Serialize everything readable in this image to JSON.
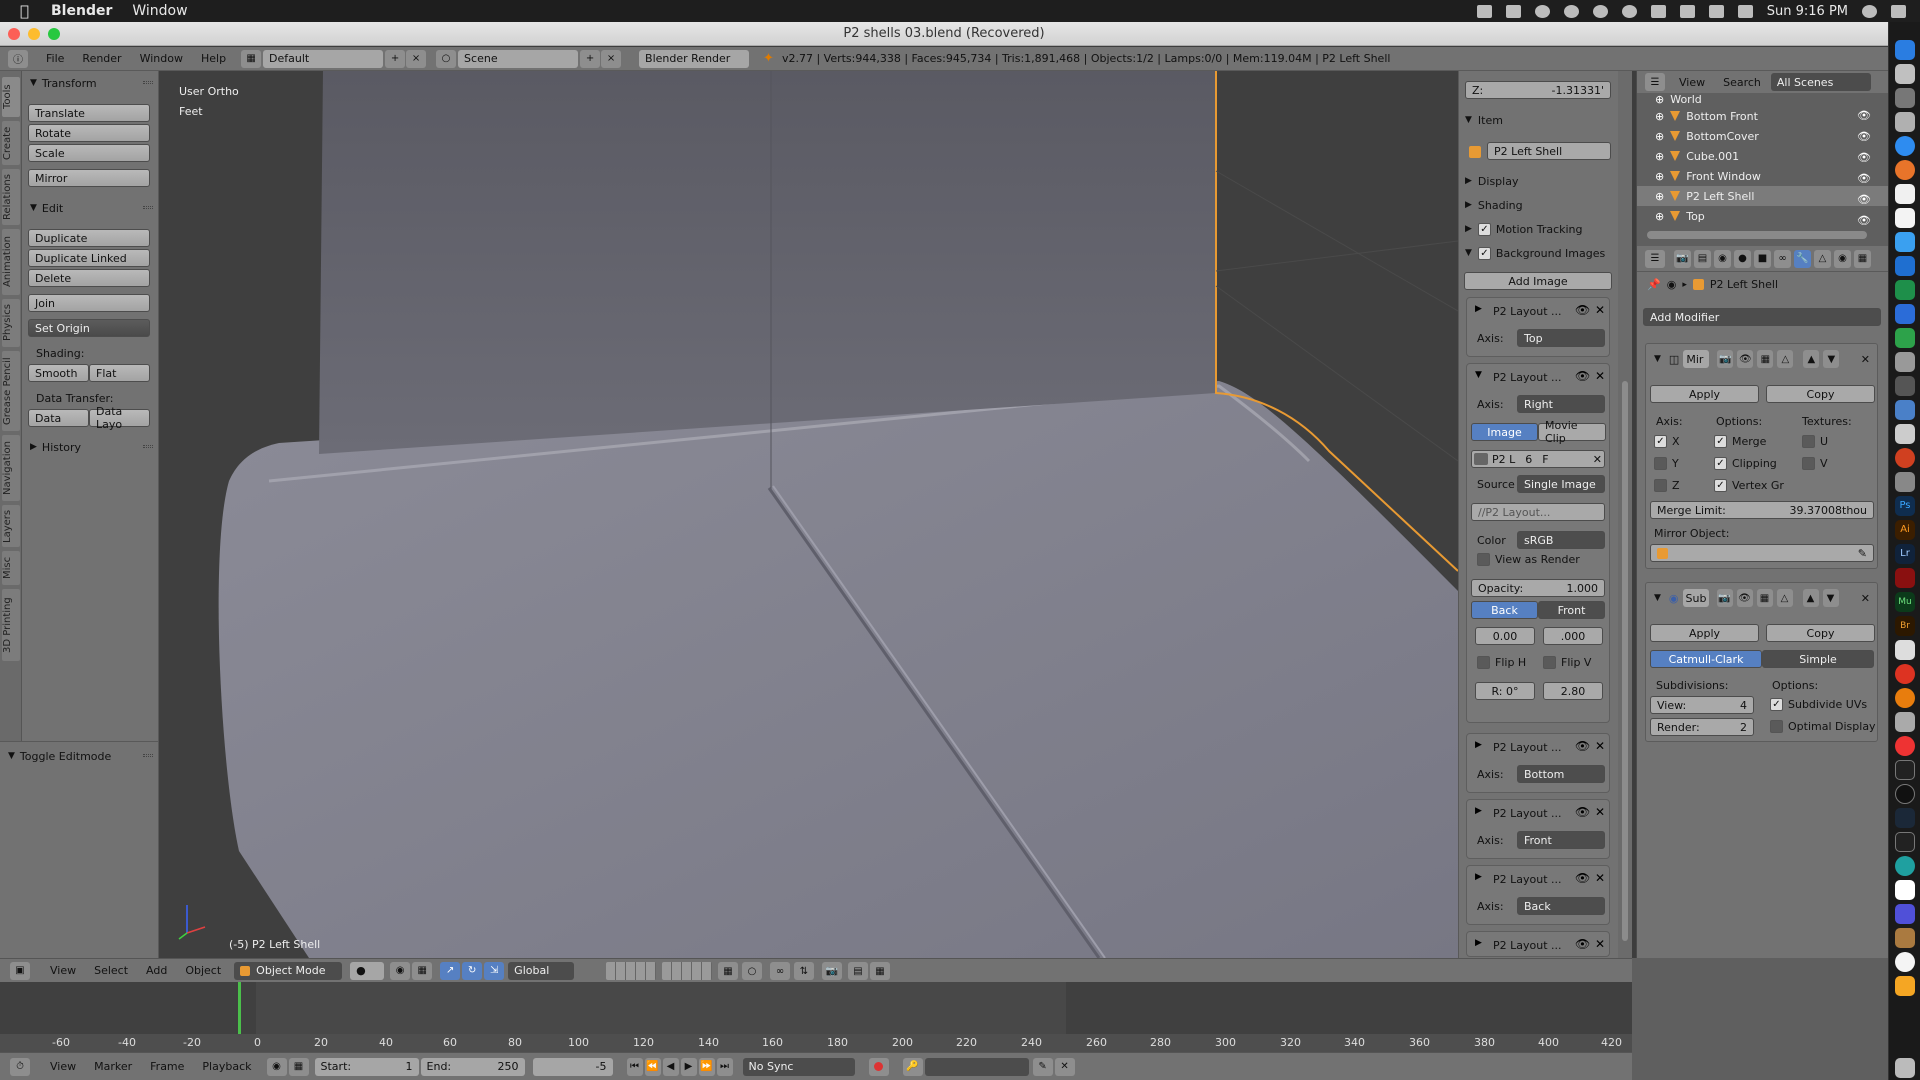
{
  "mac_menubar": {
    "app_name": "Blender",
    "menus": [
      "Window"
    ],
    "clock": "Sun 9:16 PM"
  },
  "window": {
    "title": "P2 shells 03.blend (Recovered)"
  },
  "info_header": {
    "menus": [
      "File",
      "Render",
      "Window",
      "Help"
    ],
    "layout": "Default",
    "scene": "Scene",
    "engine": "Blender Render",
    "stats": "v2.77 | Verts:944,338 | Faces:945,734 | Tris:1,891,468 | Objects:1/2 | Lamps:0/0 | Mem:119.04M | P2 Left Shell"
  },
  "toolshelf": {
    "tabs": [
      "Tools",
      "Create",
      "Relations",
      "Animation",
      "Physics",
      "Grease Pencil",
      "Navigation",
      "Layers",
      "Misc",
      "3D Printing"
    ],
    "transform": {
      "title": "Transform",
      "buttons": [
        "Translate",
        "Rotate",
        "Scale",
        "Mirror"
      ]
    },
    "edit": {
      "title": "Edit",
      "buttons": [
        "Duplicate",
        "Duplicate Linked",
        "Delete",
        "Join"
      ],
      "set_origin": "Set Origin",
      "shading_label": "Shading:",
      "smooth": "Smooth",
      "flat": "Flat",
      "data_transfer_label": "Data Transfer:",
      "data": "Data",
      "data_layout": "Data Layo"
    },
    "history": "History",
    "operator_panel": "Toggle Editmode"
  },
  "viewport": {
    "view_name": "User Ortho",
    "units": "Feet",
    "object_label": "(-5) P2 Left Shell"
  },
  "npanel": {
    "z_field": "Z:",
    "z_value": "-1.31331'",
    "item_title": "Item",
    "object_name": "P2 Left Shell",
    "display": "Display",
    "shading": "Shading",
    "motion_tracking": "Motion Tracking",
    "background_images": "Background Images",
    "add_image": "Add Image",
    "axis_label": "Axis:",
    "bg_items": [
      {
        "name": "P2 Layout ...",
        "axis": "Top",
        "expanded": false
      },
      {
        "name": "P2 Layout ...",
        "axis": "Right",
        "expanded": true
      },
      {
        "name": "P2 Layout ...",
        "axis": "Bottom",
        "expanded": false
      },
      {
        "name": "P2 Layout ...",
        "axis": "Front",
        "expanded": false
      },
      {
        "name": "P2 Layout ...",
        "axis": "Back",
        "expanded": false
      },
      {
        "name": "P2 Layout ...",
        "axis": "",
        "expanded": false
      }
    ],
    "bg_expanded": {
      "tab_image": "Image",
      "tab_movie": "Movie Clip",
      "img_name": "P2 L",
      "img_users": "6",
      "img_fake": "F",
      "source_label": "Source",
      "source_value": "Single Image",
      "path": "//P2 Layout...",
      "color_label": "Color",
      "color_value": "sRGB",
      "view_as_render": "View as Render",
      "opacity": "Opacity:",
      "opacity_value": "1.000",
      "back": "Back",
      "front": "Front",
      "x_offset": "0.00",
      "y_offset": ".000",
      "flip_h": "Flip H",
      "flip_v": "Flip V",
      "rotation": "R: 0°",
      "size": "2.80"
    }
  },
  "outliner": {
    "menus": [
      "View",
      "Search"
    ],
    "filter": "All Scenes",
    "items": [
      {
        "name": "World",
        "selected": false
      },
      {
        "name": "Bottom Front",
        "selected": false
      },
      {
        "name": "BottomCover",
        "selected": false
      },
      {
        "name": "Cube.001",
        "selected": false
      },
      {
        "name": "Front Window",
        "selected": false
      },
      {
        "name": "P2 Left Shell",
        "selected": true
      },
      {
        "name": "Top",
        "selected": false
      }
    ]
  },
  "properties": {
    "context": "P2 Left Shell",
    "add_modifier": "Add Modifier",
    "mirror": {
      "name": "Mir",
      "apply": "Apply",
      "copy": "Copy",
      "axis_label": "Axis:",
      "options_label": "Options:",
      "textures_label": "Textures:",
      "x": "X",
      "y": "Y",
      "z": "Z",
      "merge": "Merge",
      "clipping": "Clipping",
      "vertex_groups": "Vertex Gr",
      "u": "U",
      "v": "V",
      "merge_limit_label": "Merge Limit:",
      "merge_limit_value": "39.37008thou",
      "mirror_object": "Mirror Object:"
    },
    "subsurf": {
      "name": "Sub",
      "apply": "Apply",
      "copy": "Copy",
      "catmull": "Catmull-Clark",
      "simple": "Simple",
      "subdivisions": "Subdivisions:",
      "options": "Options:",
      "view_label": "View:",
      "view_value": "4",
      "render_label": "Render:",
      "render_value": "2",
      "subdivide_uvs": "Subdivide UVs",
      "optimal_display": "Optimal Display"
    }
  },
  "view3d_header": {
    "menus": [
      "View",
      "Select",
      "Add",
      "Object"
    ],
    "mode": "Object Mode",
    "orientation": "Global"
  },
  "timeline": {
    "ruler": [
      "-60",
      "-40",
      "-20",
      "0",
      "20",
      "40",
      "60",
      "80",
      "100",
      "120",
      "140",
      "160",
      "180",
      "200",
      "220",
      "240",
      "260",
      "280",
      "300",
      "320",
      "340",
      "360",
      "380",
      "400",
      "420"
    ],
    "menus": [
      "View",
      "Marker",
      "Frame",
      "Playback"
    ],
    "start": "Start:",
    "start_value": "1",
    "end": "End:",
    "end_value": "250",
    "current": "-5",
    "sync": "No Sync"
  },
  "colors": {
    "accent_blue": "#5680c2",
    "selection_orange": "#e89a33",
    "panel_grey": "#727272"
  }
}
